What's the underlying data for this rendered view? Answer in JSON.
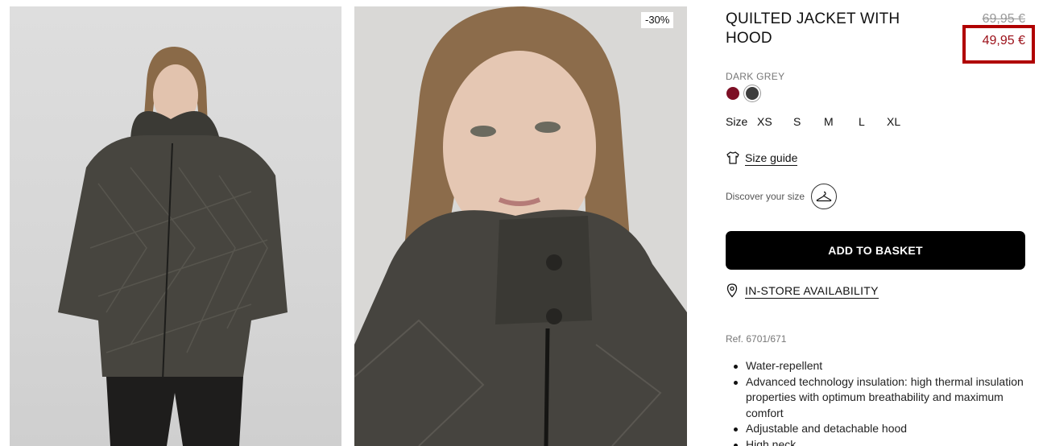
{
  "gallery": {
    "badge": "-30%"
  },
  "product": {
    "title": "QUILTED JACKET WITH HOOD",
    "price_old": "69,95 €",
    "price_new": "49,95 €",
    "color_name": "DARK GREY",
    "colors": [
      "#7d0f25",
      "#3d3d3d"
    ],
    "size_label": "Size",
    "sizes": [
      "XS",
      "S",
      "M",
      "L",
      "XL"
    ],
    "size_guide": "Size guide",
    "discover_size": "Discover your size",
    "add_to_basket": "ADD TO BASKET",
    "in_store": "IN-STORE AVAILABILITY",
    "ref": "Ref. 6701/671",
    "features": [
      "Water-repellent",
      "Advanced technology insulation: high thermal insulation properties with optimum breathability and maximum comfort",
      "Adjustable and detachable hood",
      "High neck"
    ]
  }
}
